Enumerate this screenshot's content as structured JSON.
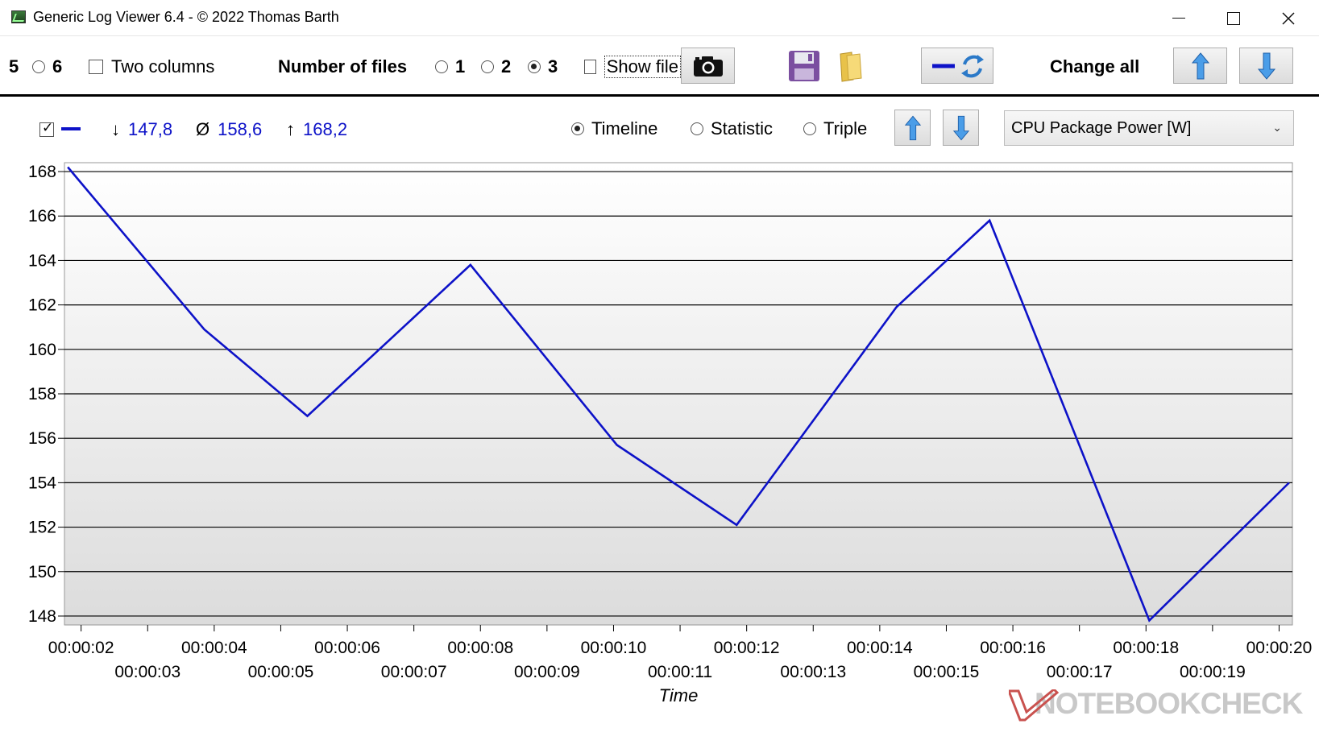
{
  "window": {
    "title": "Generic Log Viewer 6.4 - © 2022 Thomas Barth"
  },
  "toolbar": {
    "opt5_label": "5",
    "opt6_label": "6",
    "two_columns_label": "Two columns",
    "number_of_files_label": "Number of files",
    "files_options": [
      "1",
      "2",
      "3"
    ],
    "files_selected": "3",
    "show_file_label": "Show file",
    "change_all_label": "Change all"
  },
  "stats": {
    "min_symbol": "↓",
    "min_value": "147,8",
    "avg_symbol": "Ø",
    "avg_value": "158,6",
    "max_symbol": "↑",
    "max_value": "168,2",
    "series_color": "#0d12c8"
  },
  "view_modes": {
    "timeline": "Timeline",
    "statistic": "Statistic",
    "triple": "Triple",
    "selected": "Timeline"
  },
  "metric_select": {
    "selected": "CPU Package Power [W]"
  },
  "chart_data": {
    "type": "line",
    "xlabel": "Time",
    "ylabel": "",
    "ylim": [
      147.6,
      168.4
    ],
    "yticks": [
      148,
      150,
      152,
      154,
      156,
      158,
      160,
      162,
      164,
      166,
      168
    ],
    "xticks_row1": [
      "00:00:02",
      "00:00:04",
      "00:00:06",
      "00:00:08",
      "00:00:10",
      "00:00:12",
      "00:00:14",
      "00:00:16",
      "00:00:18",
      "00:00:20"
    ],
    "xticks_row2": [
      "00:00:03",
      "00:00:05",
      "00:00:07",
      "00:00:09",
      "00:00:11",
      "00:00:13",
      "00:00:15",
      "00:00:17",
      "00:00:19"
    ],
    "grid": true,
    "series": [
      {
        "color": "#0d12c8",
        "x": [
          1.8,
          3.85,
          5.4,
          7.85,
          10.05,
          11.85,
          14.25,
          15.65,
          18.05,
          20.15
        ],
        "y": [
          168.2,
          160.9,
          157.0,
          163.8,
          155.7,
          152.1,
          161.9,
          165.8,
          147.8,
          154.0
        ]
      }
    ]
  },
  "watermark": {
    "text": "NOTEBOOKCHECK"
  }
}
